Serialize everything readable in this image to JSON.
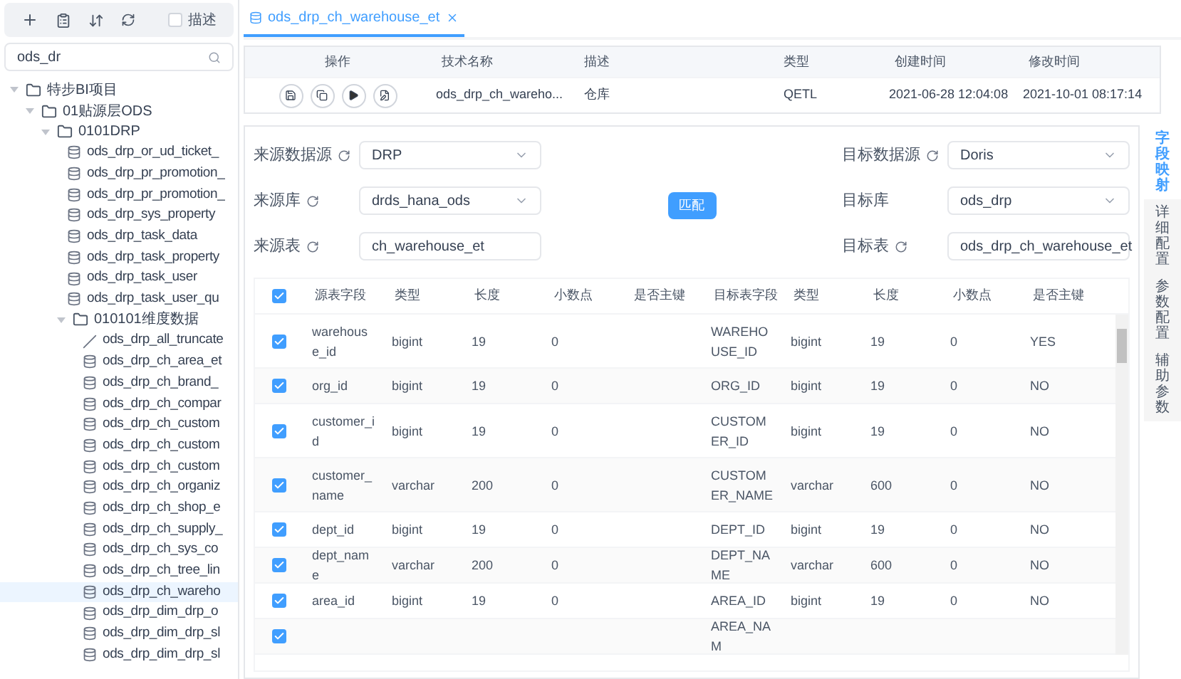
{
  "toolbar": {
    "description_toggle": {
      "label": "描述",
      "checked": false
    }
  },
  "search": {
    "value": "ods_dr"
  },
  "tree": [
    {
      "label": "特步BI项目",
      "kind": "folder",
      "expanded": true,
      "children": [
        {
          "label": "01贴源层ODS",
          "kind": "folder",
          "expanded": true,
          "children": [
            {
              "label": "0101DRP",
              "kind": "folder",
              "expanded": true,
              "children": [
                {
                  "label": "ods_drp_or_ud_ticket_",
                  "kind": "table",
                  "selected": false
                },
                {
                  "label": "ods_drp_pr_promotion_",
                  "kind": "table",
                  "selected": false
                },
                {
                  "label": "ods_drp_pr_promotion_",
                  "kind": "table",
                  "selected": false
                },
                {
                  "label": "ods_drp_sys_property",
                  "kind": "table",
                  "selected": false
                },
                {
                  "label": "ods_drp_task_data",
                  "kind": "table",
                  "selected": false
                },
                {
                  "label": "ods_drp_task_property",
                  "kind": "table",
                  "selected": false
                },
                {
                  "label": "ods_drp_task_user",
                  "kind": "table",
                  "selected": false
                },
                {
                  "label": "ods_drp_task_user_qu",
                  "kind": "table",
                  "selected": false
                },
                {
                  "label": "010101维度数据",
                  "kind": "folder",
                  "expanded": true,
                  "children": [
                    {
                      "label": "ods_drp_all_truncate",
                      "kind": "script",
                      "selected": false
                    },
                    {
                      "label": "ods_drp_ch_area_et",
                      "kind": "table",
                      "selected": false
                    },
                    {
                      "label": "ods_drp_ch_brand_",
                      "kind": "table",
                      "selected": false
                    },
                    {
                      "label": "ods_drp_ch_compar",
                      "kind": "table",
                      "selected": false
                    },
                    {
                      "label": "ods_drp_ch_custom",
                      "kind": "table",
                      "selected": false
                    },
                    {
                      "label": "ods_drp_ch_custom",
                      "kind": "table",
                      "selected": false
                    },
                    {
                      "label": "ods_drp_ch_custom",
                      "kind": "table",
                      "selected": false
                    },
                    {
                      "label": "ods_drp_ch_organiz",
                      "kind": "table",
                      "selected": false
                    },
                    {
                      "label": "ods_drp_ch_shop_e",
                      "kind": "table",
                      "selected": false
                    },
                    {
                      "label": "ods_drp_ch_supply_",
                      "kind": "table",
                      "selected": false
                    },
                    {
                      "label": "ods_drp_ch_sys_co",
                      "kind": "table",
                      "selected": false
                    },
                    {
                      "label": "ods_drp_ch_tree_lin",
                      "kind": "table",
                      "selected": false
                    },
                    {
                      "label": "ods_drp_ch_wareho",
                      "kind": "table",
                      "selected": true
                    },
                    {
                      "label": "ods_drp_dim_drp_o",
                      "kind": "table",
                      "selected": false
                    },
                    {
                      "label": "ods_drp_dim_drp_sl",
                      "kind": "table",
                      "selected": false
                    },
                    {
                      "label": "ods_drp_dim_drp_sl",
                      "kind": "table",
                      "selected": false
                    }
                  ]
                }
              ]
            }
          ]
        }
      ]
    }
  ],
  "tabs": [
    {
      "label": "ods_drp_ch_warehouse_et",
      "selected": true
    }
  ],
  "job_table": {
    "columns": [
      "操作",
      "技术名称",
      "描述",
      "类型",
      "创建时间",
      "修改时间"
    ],
    "rows": [
      {
        "name": "ods_drp_ch_wareho...",
        "description": "仓库",
        "type": "QETL",
        "created": "2021-06-28 12:04:08",
        "modified": "2021-10-01 08:17:14"
      }
    ]
  },
  "form": {
    "left": [
      {
        "label": "来源数据源",
        "kind": "select",
        "value": "DRP",
        "refreshable": true
      },
      {
        "label": "来源库",
        "kind": "select",
        "value": "drds_hana_ods",
        "refreshable": true
      },
      {
        "label": "来源表",
        "kind": "input",
        "value": "ch_warehouse_et",
        "refreshable": true
      }
    ],
    "right": [
      {
        "label": "目标数据源",
        "kind": "select",
        "value": "Doris",
        "refreshable": true
      },
      {
        "label": "目标库",
        "kind": "select",
        "value": "ods_drp",
        "refreshable": false
      },
      {
        "label": "目标表",
        "kind": "input",
        "value": "ods_drp_ch_warehouse_et",
        "refreshable": true
      }
    ],
    "match_button": "匹配"
  },
  "mapping_table": {
    "all_checked": true,
    "columns": [
      "源表字段",
      "类型",
      "长度",
      "小数点",
      "是否主键",
      "目标表字段",
      "类型",
      "长度",
      "小数点",
      "是否主键"
    ],
    "rows": [
      {
        "checked": true,
        "cells": [
          "warehouse_id",
          "bigint",
          "19",
          "0",
          "",
          "WAREHOUSE_ID",
          "bigint",
          "19",
          "0",
          "YES"
        ]
      },
      {
        "checked": true,
        "cells": [
          "org_id",
          "bigint",
          "19",
          "0",
          "",
          "ORG_ID",
          "bigint",
          "19",
          "0",
          "NO"
        ]
      },
      {
        "checked": true,
        "cells": [
          "customer_id",
          "bigint",
          "19",
          "0",
          "",
          "CUSTOMER_ID",
          "bigint",
          "19",
          "0",
          "NO"
        ]
      },
      {
        "checked": true,
        "cells": [
          "customer_name",
          "varchar",
          "200",
          "0",
          "",
          "CUSTOMER_NAME",
          "varchar",
          "600",
          "0",
          "NO"
        ]
      },
      {
        "checked": true,
        "cells": [
          "dept_id",
          "bigint",
          "19",
          "0",
          "",
          "DEPT_ID",
          "bigint",
          "19",
          "0",
          "NO"
        ]
      },
      {
        "checked": true,
        "cells": [
          "dept_name",
          "varchar",
          "200",
          "0",
          "",
          "DEPT_NAME",
          "varchar",
          "600",
          "0",
          "NO"
        ]
      },
      {
        "checked": true,
        "cells": [
          "area_id",
          "bigint",
          "19",
          "0",
          "",
          "AREA_ID",
          "bigint",
          "19",
          "0",
          "NO"
        ]
      },
      {
        "checked": true,
        "cells": [
          "",
          "",
          "",
          "",
          "",
          "AREA_NAM",
          "",
          "",
          "",
          ""
        ]
      }
    ]
  },
  "side_tabs": [
    {
      "label": "字段映射",
      "selected": true
    },
    {
      "label": "详细配置",
      "selected": false
    },
    {
      "label": "参数配置",
      "selected": false
    },
    {
      "label": "辅助参数",
      "selected": false
    }
  ]
}
